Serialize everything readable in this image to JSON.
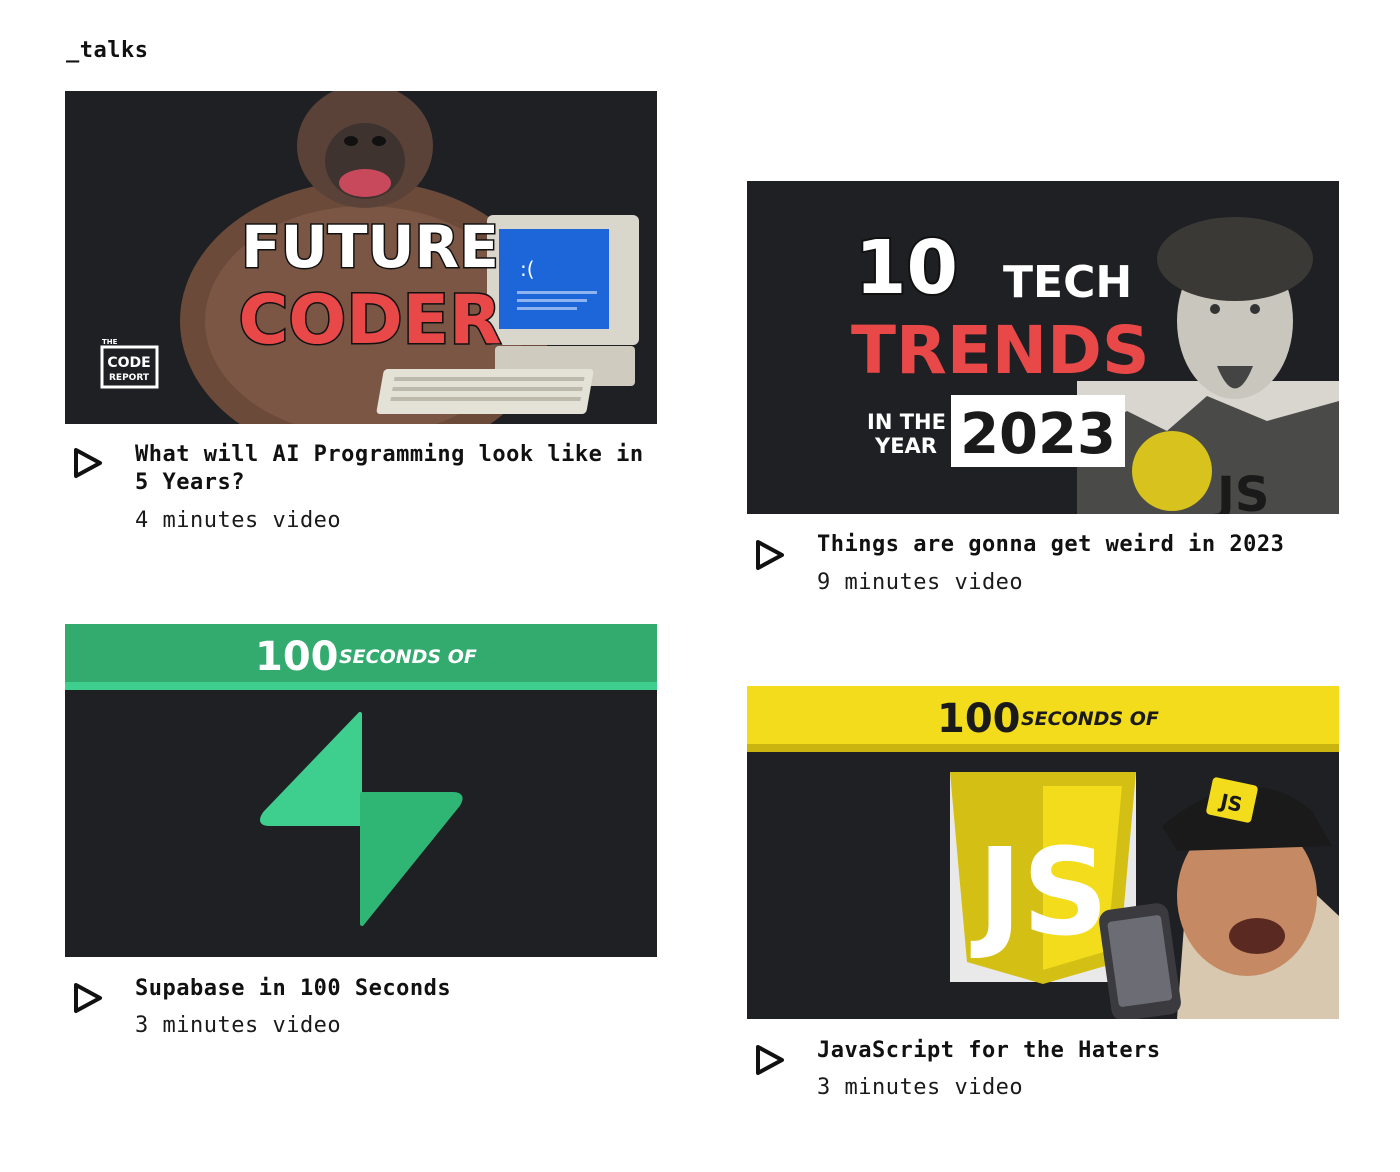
{
  "section": {
    "title": "_talks"
  },
  "videos": [
    {
      "title": "What will AI Programming look like in 5 Years?",
      "duration": "4 minutes video",
      "thumbnail": {
        "line1": "FUTURE",
        "line2": "CODER",
        "badge_top": "THE",
        "badge_line1": "CODE",
        "badge_line2": "REPORT",
        "screen_face": ":(",
        "bg": "#1f2024",
        "accent": "#e84848"
      }
    },
    {
      "title": "Things are gonna get weird in 2023",
      "duration": "9 minutes video",
      "thumbnail": {
        "number": "10",
        "word1": "TECH",
        "word2": "TRENDS",
        "prefix_line1": "IN THE",
        "prefix_line2": "YEAR",
        "year": "2023",
        "logo": "JS",
        "bg": "#1f2024",
        "accent": "#e84848"
      }
    },
    {
      "title": "Supabase in 100 Seconds",
      "duration": "3 minutes video",
      "thumbnail": {
        "banner_number": "100",
        "banner_text": "SECONDS OF",
        "banner_color": "#33aa6e",
        "logo_color": "#3ecf8e",
        "bg": "#1f2024"
      }
    },
    {
      "title": "JavaScript for the Haters",
      "duration": "3 minutes video",
      "thumbnail": {
        "banner_number": "100",
        "banner_text": "SECONDS OF",
        "banner_color": "#f2dc1c",
        "shield_text": "JS",
        "cap_text": "JS",
        "bg": "#1f2024"
      }
    }
  ],
  "icons": {
    "play": "play-icon"
  }
}
